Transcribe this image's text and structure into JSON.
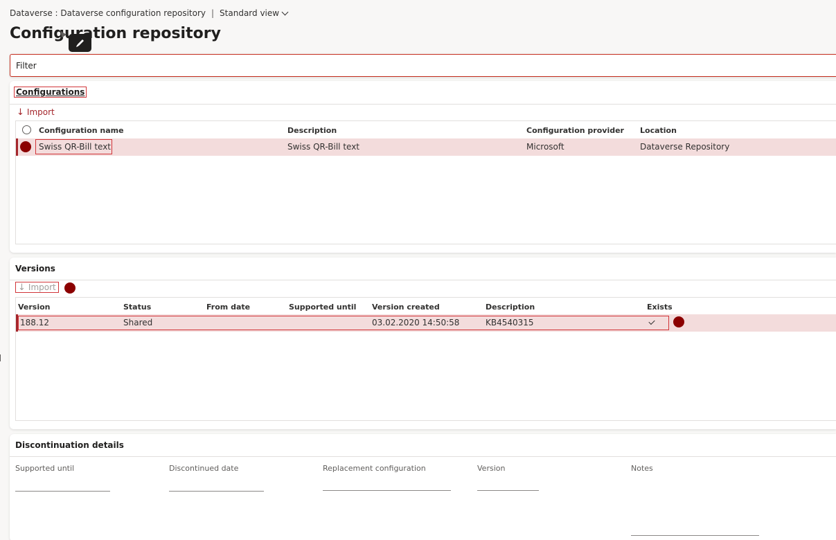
{
  "breadcrumb": {
    "path": "Dataverse : Dataverse configuration repository",
    "separator": "|",
    "view": "Standard view"
  },
  "page": {
    "title": "Configuration repository"
  },
  "filter": {
    "label": "Filter"
  },
  "configurations": {
    "title": "Configurations",
    "import_label": "Import",
    "columns": [
      "Configuration name",
      "Description",
      "Configuration provider",
      "Location"
    ],
    "rows": [
      {
        "name": "Swiss QR-Bill text",
        "description": "Swiss QR-Bill text",
        "provider": "Microsoft",
        "location": "Dataverse Repository"
      }
    ]
  },
  "versions": {
    "title": "Versions",
    "import_label": "Import",
    "columns": [
      "Version",
      "Status",
      "From date",
      "Supported until",
      "Version created",
      "Description",
      "Exists"
    ],
    "rows": [
      {
        "version": "188.12",
        "status": "Shared",
        "from_date": "",
        "supported_until": "",
        "created": "03.02.2020 14:50:58",
        "description": "KB4540315",
        "exists": true
      }
    ]
  },
  "discontinuation": {
    "title": "Discontinuation details",
    "fields": [
      "Supported until",
      "Discontinued date",
      "Replacement configuration",
      "Version",
      "Notes"
    ]
  },
  "colors": {
    "accent": "#a4262c",
    "highlight_border": "#d13438",
    "selected_row": "#f3dcdc",
    "step_marker": "#8b0000"
  },
  "icons": {
    "import": "download-arrow-icon",
    "tooltip": "pen-icon",
    "view_dropdown": "chevron-down-icon",
    "exists": "checkmark-icon"
  }
}
